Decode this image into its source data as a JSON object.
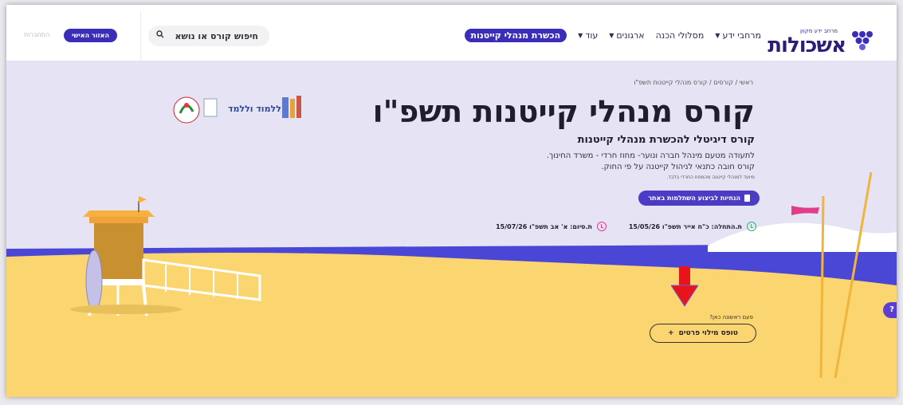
{
  "header": {
    "logo_sub": "מרחב ידע מקוון",
    "logo_main": "אשכולות",
    "nav": [
      {
        "label": "מרחבי ידע",
        "has_caret": true
      },
      {
        "label": "מסלולי הכנה",
        "has_caret": false
      },
      {
        "label": "ארגונים",
        "has_caret": true
      },
      {
        "label": "עוד",
        "has_caret": true
      },
      {
        "label": "הכשרת מנהלי קייטנות",
        "has_caret": false,
        "active": true
      }
    ],
    "search_placeholder": "חיפוש קורס או נושא",
    "search_icon": "search-icon",
    "personal_area": "האזור האישי",
    "login": "התחברות"
  },
  "hero": {
    "breadcrumb": "ראשי / קורסים / קורס מנהלי קייטנות תשפ\"ו",
    "title": "קורס מנהלי קייטנות תשפ\"ו",
    "subtitle": "קורס דיגיטלי להכשרת מנהלי קייטנות",
    "desc_line1": "לתעודה מטעם מינהל חברה ונוער- מחוז חרדי - משרד החינוך.",
    "desc_line2": "קורס חובה כתנאי לניהול קייטנה על פי החוק.",
    "desc_line3": "מיועד למנהלי קייטנה מהמחוז החרדי בלבד.",
    "cta": "הנחיות לביצוע השתלמות באתר",
    "cta_icon": "document-icon",
    "start_date": "ת.התחלה: כ\"ח אייר תשפ\"ו 15/05/26",
    "end_date": "ת.סיום: א' אב תשפ\"ו 15/07/26",
    "first_time": "פעם ראשונה כאן?",
    "form_button": "טופס מילוי פרטים",
    "form_button_icon": "+",
    "partners_text": "ללמוד וללמד",
    "arrow_color": "#e8141b"
  },
  "colors": {
    "brand": "#3b2db8",
    "sky": "#e6e3f5",
    "sea": "#4b47d6",
    "sand": "#fbd570",
    "arrow": "#e8141b"
  }
}
